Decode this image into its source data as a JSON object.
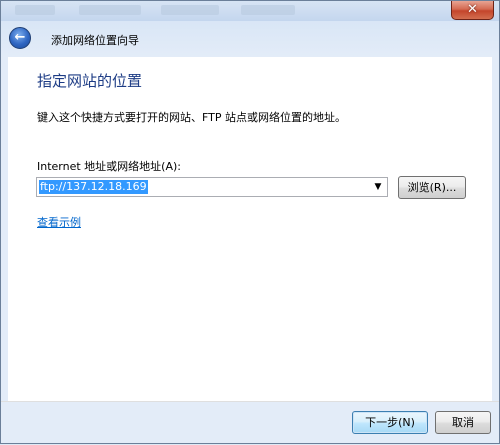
{
  "window": {
    "close_glyph": "✕"
  },
  "navbar": {
    "back_glyph": "←",
    "title": "添加网络位置向导"
  },
  "content": {
    "heading": "指定网站的位置",
    "instruction": "键入这个快捷方式要打开的网站、FTP 站点或网络位置的地址。",
    "address_label": "Internet 地址或网络地址(A):",
    "address_value": "ftp://137.12.18.169",
    "dropdown_glyph": "▼",
    "browse_label": "浏览(R)...",
    "example_link": "查看示例"
  },
  "footer": {
    "next_label": "下一步(N)",
    "cancel_label": "取消"
  },
  "colors": {
    "heading": "#1d3c85",
    "link": "#0066cc",
    "selection": "#3399ff",
    "close": "#c4452b"
  },
  "icons": {
    "back": "back-arrow-icon",
    "close": "close-icon",
    "dropdown": "chevron-down-icon"
  }
}
